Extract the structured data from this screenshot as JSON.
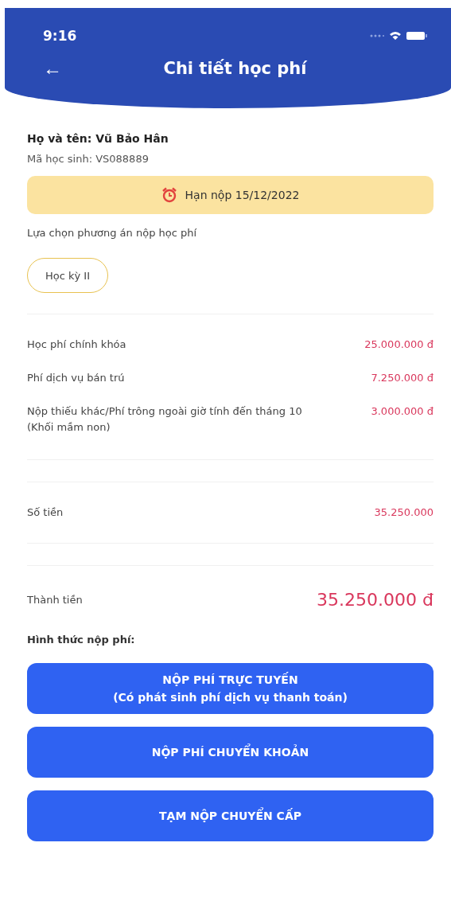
{
  "status_bar": {
    "time": "9:16"
  },
  "header": {
    "back": "←",
    "title": "Chi tiết học phí"
  },
  "student": {
    "name": "Họ và tên: Vũ Bảo Hân",
    "id": "Mã học sinh: VS088889"
  },
  "deadline": "Hạn nộp 15/12/2022",
  "plan": {
    "label": "Lựa chọn phương án nộp học phí",
    "options": [
      {
        "label": "Học kỳ II",
        "selected": true
      }
    ]
  },
  "fees": [
    {
      "name": "Học phí chính khóa",
      "amount": "25.000.000 đ"
    },
    {
      "name": "Phí dịch vụ bán trú",
      "amount": "7.250.000 đ"
    },
    {
      "name": "Nộp thiếu khác/Phí trông ngoài giờ tính đến tháng 10 (Khối mầm non)",
      "amount": "3.000.000 đ"
    }
  ],
  "subtotal": {
    "label": "Số tiền",
    "amount": "35.250.000"
  },
  "total": {
    "label": "Thành tiền",
    "amount": "35.250.000 đ"
  },
  "payment": {
    "label": "Hình thức nộp phí:",
    "buttons": [
      {
        "title": "NỘP PHÍ TRỰC TUYẾN",
        "subtitle": "(Có phát sinh phí dịch vụ thanh toán)"
      },
      {
        "title": "NỘP PHÍ CHUYỂN KHOẢN"
      },
      {
        "title": "TẠM NỘP CHUYỂN CẤP"
      }
    ]
  }
}
